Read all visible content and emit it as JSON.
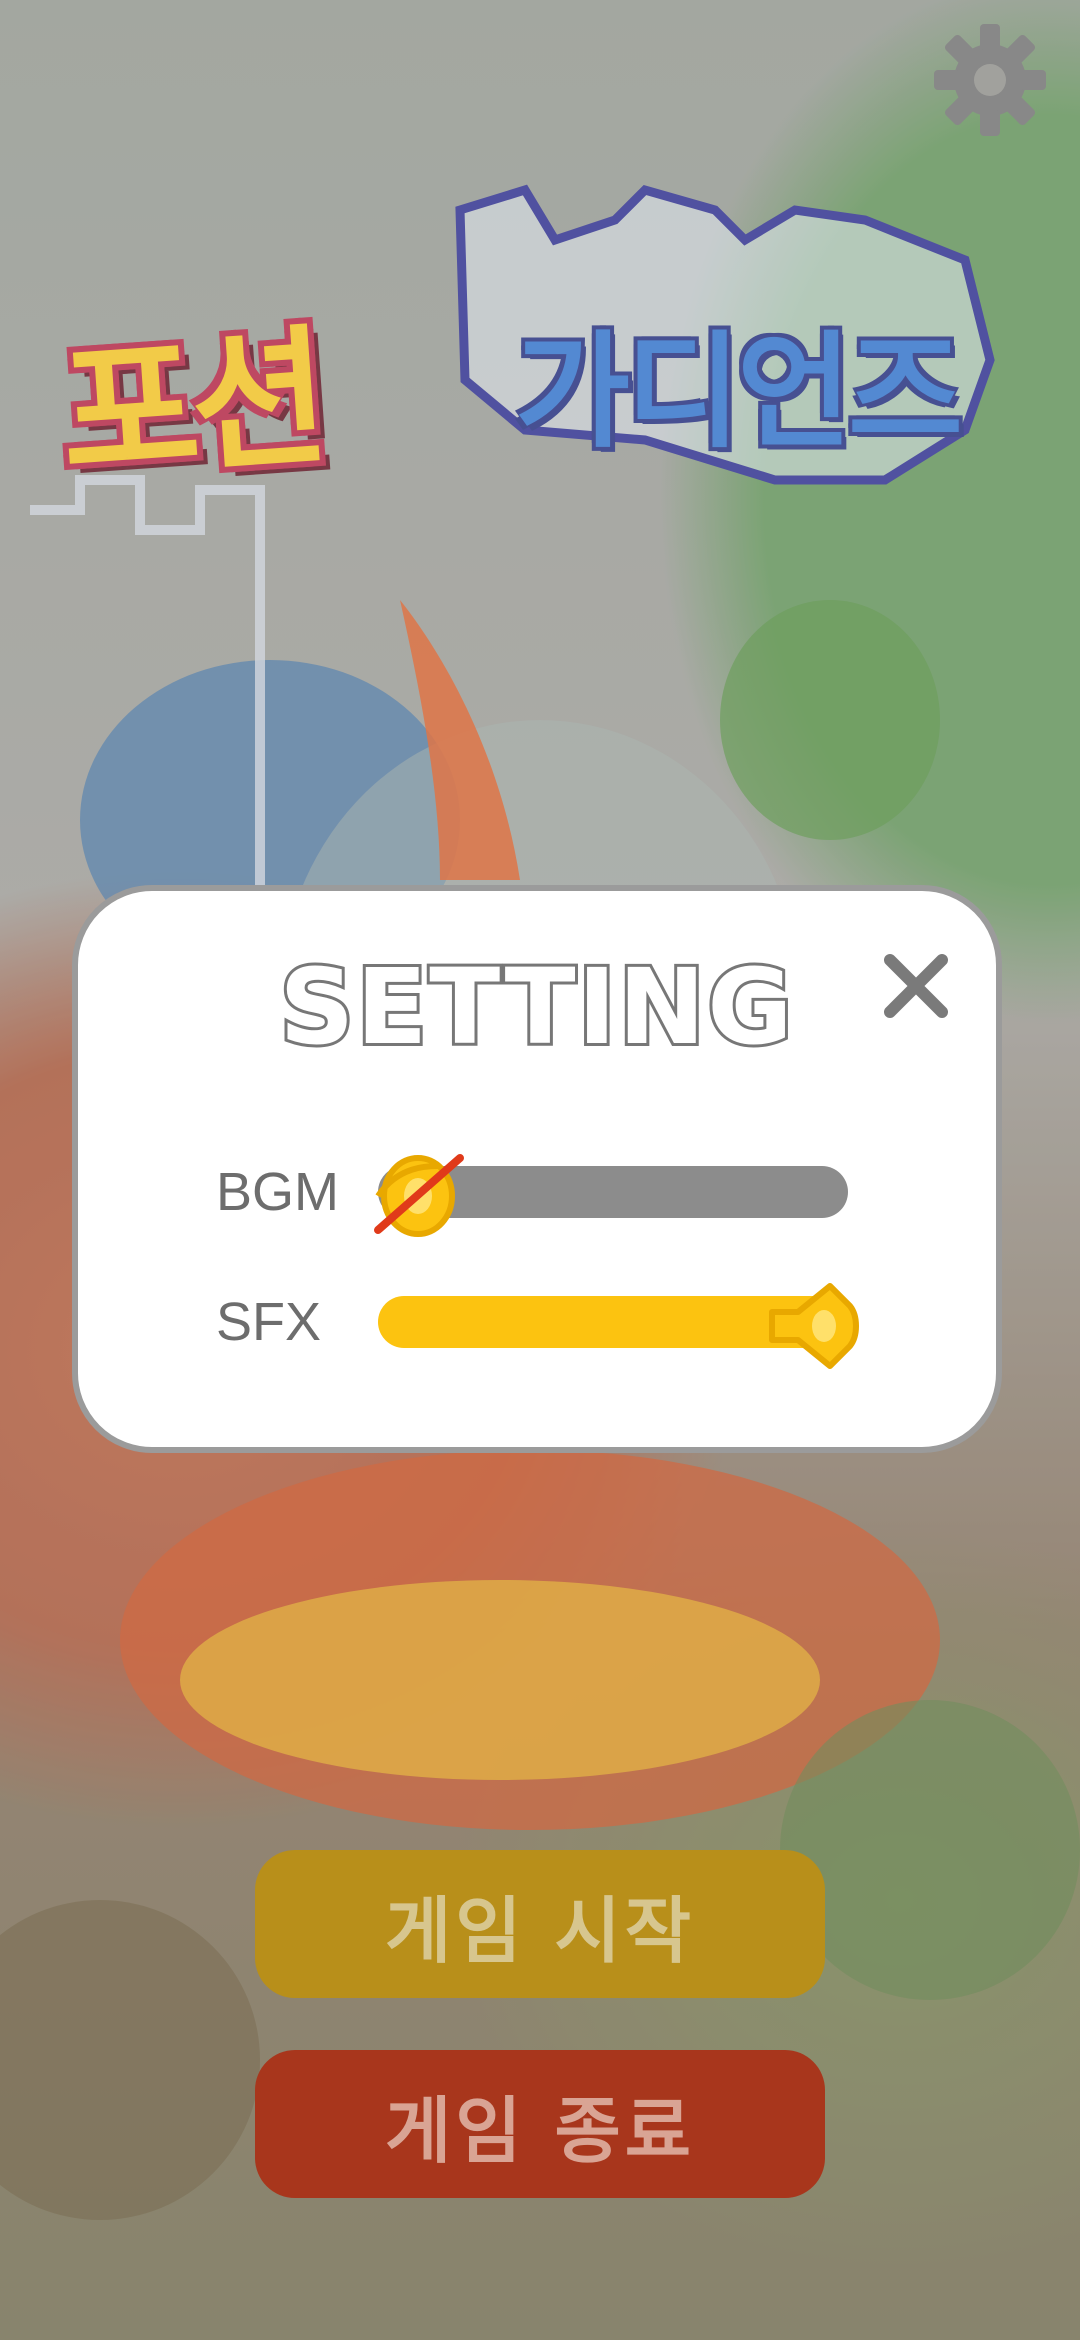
{
  "logo": {
    "part1": "포션",
    "part2": "가디언즈"
  },
  "settings_dialog": {
    "title": "SETTING",
    "bgm_label": "BGM",
    "bgm_level": 0,
    "bgm_muted": true,
    "sfx_label": "SFX",
    "sfx_level": 1.0,
    "sfx_muted": false
  },
  "menu": {
    "start_label": "게임 시작",
    "quit_label": "게임 종료"
  },
  "icons": {
    "settings": "gear-icon",
    "close": "close-icon",
    "bgm_handle": "speaker-muted-icon",
    "sfx_handle": "speaker-icon"
  },
  "colors": {
    "slider_fill": "#fcc310",
    "slider_track": "#8c8c8c",
    "start_button": "#b88f1a",
    "quit_button": "#a8361c",
    "mute_slash": "#e03a1a"
  }
}
